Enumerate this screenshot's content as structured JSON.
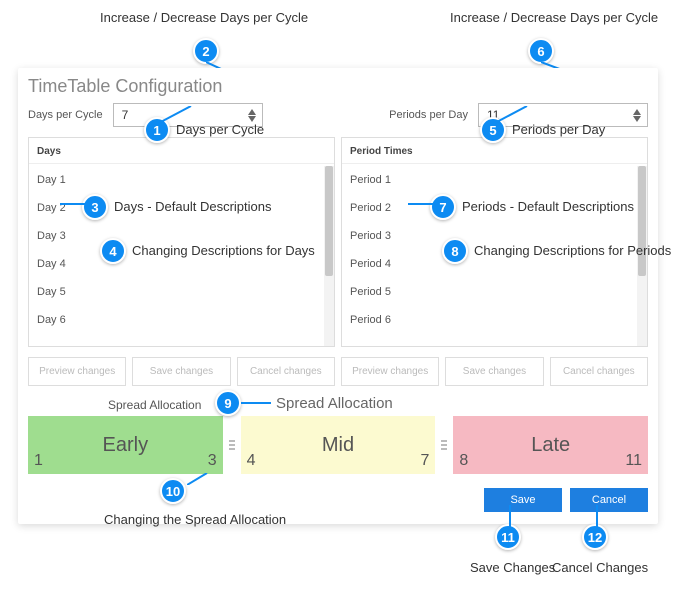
{
  "annotations": {
    "top_left": "Increase / Decrease Days per Cycle",
    "top_right": "Increase / Decrease Days per Cycle",
    "a1": "Days per Cycle",
    "a3": "Days - Default Descriptions",
    "a4": "Changing Descriptions for Days",
    "a5": "Periods per Day",
    "a7": "Periods - Default Descriptions",
    "a8": "Changing Descriptions for Periods",
    "a9": "Spread Allocation",
    "a10": "Changing the Spread Allocation",
    "a11": "Save Changes",
    "a12": "Cancel Changes",
    "n1": "1",
    "n2": "2",
    "n3": "3",
    "n4": "4",
    "n5": "5",
    "n6": "6",
    "n7": "7",
    "n8": "8",
    "n9": "9",
    "n10": "10",
    "n11": "11",
    "n12": "12"
  },
  "panel": {
    "title": "TimeTable Configuration",
    "daysPerCycle": {
      "label": "Days per Cycle",
      "value": "7"
    },
    "periodsPerDay": {
      "label": "Periods per Day",
      "value": "11"
    },
    "days": {
      "header": "Days",
      "items": [
        "Day 1",
        "Day 2",
        "Day 3",
        "Day 4",
        "Day 5",
        "Day 6"
      ]
    },
    "periods": {
      "header": "Period Times",
      "items": [
        "Period 1",
        "Period 2",
        "Period 3",
        "Period 4",
        "Period 5",
        "Period 6"
      ]
    },
    "buttons": {
      "preview": "Preview changes",
      "save": "Save changes",
      "cancel": "Cancel changes"
    },
    "spread": {
      "label": "Spread Allocation",
      "early": {
        "name": "Early",
        "from": "1",
        "to": "3"
      },
      "mid": {
        "name": "Mid",
        "from": "4",
        "to": "7"
      },
      "late": {
        "name": "Late",
        "from": "8",
        "to": "11"
      }
    },
    "footer": {
      "save": "Save",
      "cancel": "Cancel"
    }
  }
}
